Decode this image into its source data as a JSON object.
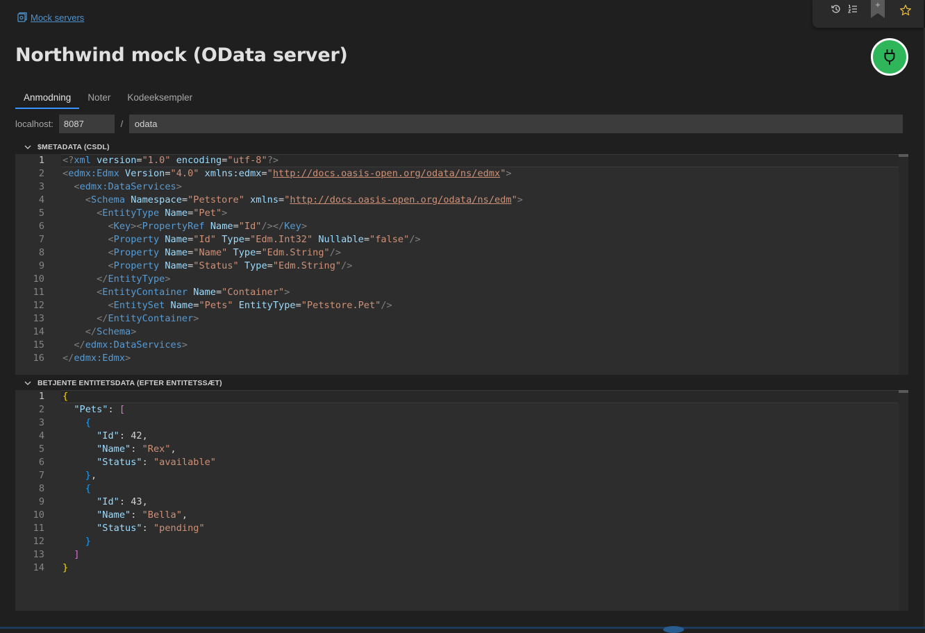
{
  "breadcrumb": {
    "icon": "mock-server-icon",
    "label": "Mock servers"
  },
  "title": "Northwind mock (OData server)",
  "toolbar": {
    "icons": [
      "history-icon",
      "list-icon",
      "bookmark-icon",
      "star-icon"
    ]
  },
  "power": {
    "icon": "plug-icon",
    "color": "#2fb55a"
  },
  "tabs": [
    {
      "label": "Anmodning"
    },
    {
      "label": "Noter"
    },
    {
      "label": "Kodeeksempler"
    }
  ],
  "url": {
    "host_label": "localhost:",
    "port": "8087",
    "separator": "/",
    "path": "odata"
  },
  "metadata": {
    "header": "$METADATA (CSDL)",
    "lines": [
      [
        [
          "<?",
          "p"
        ],
        [
          "xml",
          "t"
        ],
        [
          " version",
          "a"
        ],
        [
          "=",
          "x"
        ],
        [
          "\"1.0\"",
          "s"
        ],
        [
          " encoding",
          "a"
        ],
        [
          "=",
          "x"
        ],
        [
          "\"utf-8\"",
          "s"
        ],
        [
          "?>",
          "p"
        ]
      ],
      [
        [
          "<",
          "p"
        ],
        [
          "edmx:Edmx",
          "t"
        ],
        [
          " Version",
          "a"
        ],
        [
          "=",
          "x"
        ],
        [
          "\"4.0\"",
          "s"
        ],
        [
          " xmlns:edmx",
          "a"
        ],
        [
          "=",
          "x"
        ],
        [
          "\"",
          "s"
        ],
        [
          "http://docs.oasis-open.org/odata/ns/edmx",
          "l"
        ],
        [
          "\"",
          "s"
        ],
        [
          ">",
          "p"
        ]
      ],
      [
        [
          "  ",
          "x"
        ],
        [
          "<",
          "p"
        ],
        [
          "edmx:DataServices",
          "t"
        ],
        [
          ">",
          "p"
        ]
      ],
      [
        [
          "    ",
          "x"
        ],
        [
          "<",
          "p"
        ],
        [
          "Schema",
          "t"
        ],
        [
          " Namespace",
          "a"
        ],
        [
          "=",
          "x"
        ],
        [
          "\"Petstore\"",
          "s"
        ],
        [
          " xmlns",
          "a"
        ],
        [
          "=",
          "x"
        ],
        [
          "\"",
          "s"
        ],
        [
          "http://docs.oasis-open.org/odata/ns/edm",
          "l"
        ],
        [
          "\"",
          "s"
        ],
        [
          ">",
          "p"
        ]
      ],
      [
        [
          "      ",
          "x"
        ],
        [
          "<",
          "p"
        ],
        [
          "EntityType",
          "t"
        ],
        [
          " Name",
          "a"
        ],
        [
          "=",
          "x"
        ],
        [
          "\"Pet\"",
          "s"
        ],
        [
          ">",
          "p"
        ]
      ],
      [
        [
          "        ",
          "x"
        ],
        [
          "<",
          "p"
        ],
        [
          "Key",
          "t"
        ],
        [
          "><",
          "p"
        ],
        [
          "PropertyRef",
          "t"
        ],
        [
          " Name",
          "a"
        ],
        [
          "=",
          "x"
        ],
        [
          "\"Id\"",
          "s"
        ],
        [
          "/></",
          "p"
        ],
        [
          "Key",
          "t"
        ],
        [
          ">",
          "p"
        ]
      ],
      [
        [
          "        ",
          "x"
        ],
        [
          "<",
          "p"
        ],
        [
          "Property",
          "t"
        ],
        [
          " Name",
          "a"
        ],
        [
          "=",
          "x"
        ],
        [
          "\"Id\"",
          "s"
        ],
        [
          " Type",
          "a"
        ],
        [
          "=",
          "x"
        ],
        [
          "\"Edm.Int32\"",
          "s"
        ],
        [
          " Nullable",
          "a"
        ],
        [
          "=",
          "x"
        ],
        [
          "\"false\"",
          "s"
        ],
        [
          "/>",
          "p"
        ]
      ],
      [
        [
          "        ",
          "x"
        ],
        [
          "<",
          "p"
        ],
        [
          "Property",
          "t"
        ],
        [
          " Name",
          "a"
        ],
        [
          "=",
          "x"
        ],
        [
          "\"Name\"",
          "s"
        ],
        [
          " Type",
          "a"
        ],
        [
          "=",
          "x"
        ],
        [
          "\"Edm.String\"",
          "s"
        ],
        [
          "/>",
          "p"
        ]
      ],
      [
        [
          "        ",
          "x"
        ],
        [
          "<",
          "p"
        ],
        [
          "Property",
          "t"
        ],
        [
          " Name",
          "a"
        ],
        [
          "=",
          "x"
        ],
        [
          "\"Status\"",
          "s"
        ],
        [
          " Type",
          "a"
        ],
        [
          "=",
          "x"
        ],
        [
          "\"Edm.String\"",
          "s"
        ],
        [
          "/>",
          "p"
        ]
      ],
      [
        [
          "      ",
          "x"
        ],
        [
          "</",
          "p"
        ],
        [
          "EntityType",
          "t"
        ],
        [
          ">",
          "p"
        ]
      ],
      [
        [
          "      ",
          "x"
        ],
        [
          "<",
          "p"
        ],
        [
          "EntityContainer",
          "t"
        ],
        [
          " Name",
          "a"
        ],
        [
          "=",
          "x"
        ],
        [
          "\"Container\"",
          "s"
        ],
        [
          ">",
          "p"
        ]
      ],
      [
        [
          "        ",
          "x"
        ],
        [
          "<",
          "p"
        ],
        [
          "EntitySet",
          "t"
        ],
        [
          " Name",
          "a"
        ],
        [
          "=",
          "x"
        ],
        [
          "\"Pets\"",
          "s"
        ],
        [
          " EntityType",
          "a"
        ],
        [
          "=",
          "x"
        ],
        [
          "\"Petstore.Pet\"",
          "s"
        ],
        [
          "/>",
          "p"
        ]
      ],
      [
        [
          "      ",
          "x"
        ],
        [
          "</",
          "p"
        ],
        [
          "EntityContainer",
          "t"
        ],
        [
          ">",
          "p"
        ]
      ],
      [
        [
          "    ",
          "x"
        ],
        [
          "</",
          "p"
        ],
        [
          "Schema",
          "t"
        ],
        [
          ">",
          "p"
        ]
      ],
      [
        [
          "  ",
          "x"
        ],
        [
          "</",
          "p"
        ],
        [
          "edmx:DataServices",
          "t"
        ],
        [
          ">",
          "p"
        ]
      ],
      [
        [
          "</",
          "p"
        ],
        [
          "edmx:Edmx",
          "t"
        ],
        [
          ">",
          "p"
        ]
      ]
    ]
  },
  "entities": {
    "header": "BETJENTE ENTITETSDATA (EFTER ENTITETSSÆT)",
    "lines": [
      [
        [
          "{",
          "b1"
        ]
      ],
      [
        [
          "  ",
          "x"
        ],
        [
          "\"Pets\"",
          "k"
        ],
        [
          ": ",
          "x"
        ],
        [
          "[",
          "b2"
        ]
      ],
      [
        [
          "    ",
          "x"
        ],
        [
          "{",
          "b3"
        ]
      ],
      [
        [
          "      ",
          "x"
        ],
        [
          "\"Id\"",
          "k"
        ],
        [
          ": ",
          "x"
        ],
        [
          "42",
          "x"
        ],
        [
          ",",
          "x"
        ]
      ],
      [
        [
          "      ",
          "x"
        ],
        [
          "\"Name\"",
          "k"
        ],
        [
          ": ",
          "x"
        ],
        [
          "\"Rex\"",
          "s"
        ],
        [
          ",",
          "x"
        ]
      ],
      [
        [
          "      ",
          "x"
        ],
        [
          "\"Status\"",
          "k"
        ],
        [
          ": ",
          "x"
        ],
        [
          "\"available\"",
          "s"
        ]
      ],
      [
        [
          "    ",
          "x"
        ],
        [
          "}",
          "b3"
        ],
        [
          ",",
          "x"
        ]
      ],
      [
        [
          "    ",
          "x"
        ],
        [
          "{",
          "b3"
        ]
      ],
      [
        [
          "      ",
          "x"
        ],
        [
          "\"Id\"",
          "k"
        ],
        [
          ": ",
          "x"
        ],
        [
          "43",
          "x"
        ],
        [
          ",",
          "x"
        ]
      ],
      [
        [
          "      ",
          "x"
        ],
        [
          "\"Name\"",
          "k"
        ],
        [
          ": ",
          "x"
        ],
        [
          "\"Bella\"",
          "s"
        ],
        [
          ",",
          "x"
        ]
      ],
      [
        [
          "      ",
          "x"
        ],
        [
          "\"Status\"",
          "k"
        ],
        [
          ": ",
          "x"
        ],
        [
          "\"pending\"",
          "s"
        ]
      ],
      [
        [
          "    ",
          "x"
        ],
        [
          "}",
          "b3"
        ]
      ],
      [
        [
          "  ",
          "x"
        ],
        [
          "]",
          "b2"
        ]
      ],
      [
        [
          "}",
          "b1"
        ]
      ]
    ]
  }
}
